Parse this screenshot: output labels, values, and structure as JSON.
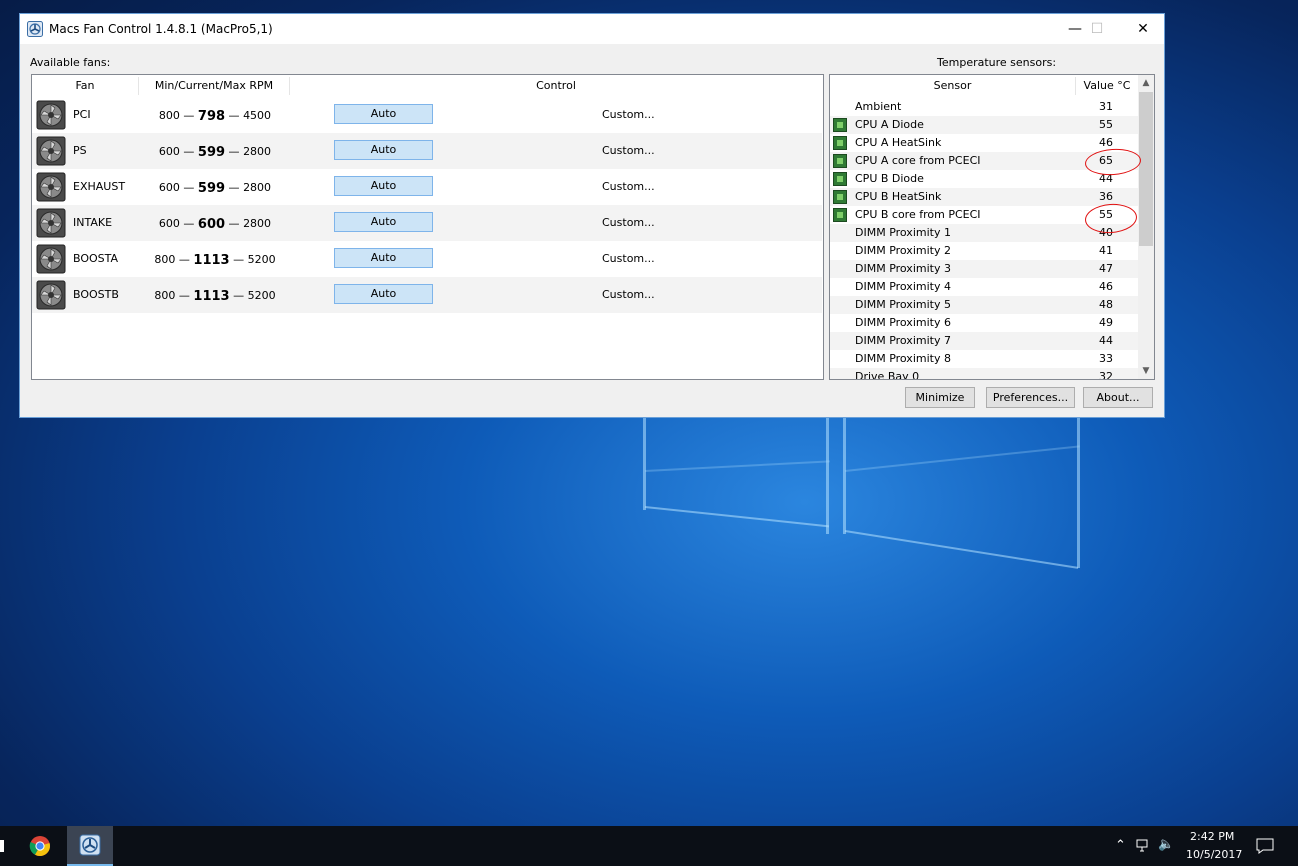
{
  "window": {
    "title": "Macs Fan Control 1.4.8.1 (MacPro5,1)",
    "minimize_glyph": "—",
    "maximize_glyph": "☐",
    "close_glyph": "✕"
  },
  "fans_panel": {
    "label": "Available fans:",
    "headers": {
      "fan": "Fan",
      "rpm": "Min/Current/Max RPM",
      "control": "Control"
    },
    "fans": [
      {
        "name": "PCI",
        "min": "800",
        "current": "798",
        "max": "4500",
        "control": "Auto",
        "custom": "Custom..."
      },
      {
        "name": "PS",
        "min": "600",
        "current": "599",
        "max": "2800",
        "control": "Auto",
        "custom": "Custom..."
      },
      {
        "name": "EXHAUST",
        "min": "600",
        "current": "599",
        "max": "2800",
        "control": "Auto",
        "custom": "Custom..."
      },
      {
        "name": "INTAKE",
        "min": "600",
        "current": "600",
        "max": "2800",
        "control": "Auto",
        "custom": "Custom..."
      },
      {
        "name": "BOOSTA",
        "min": "800",
        "current": "1113",
        "max": "5200",
        "control": "Auto",
        "custom": "Custom..."
      },
      {
        "name": "BOOSTB",
        "min": "800",
        "current": "1113",
        "max": "5200",
        "control": "Auto",
        "custom": "Custom..."
      }
    ]
  },
  "sensors_panel": {
    "label": "Temperature sensors:",
    "headers": {
      "sensor": "Sensor",
      "value": "Value °C"
    },
    "sensors": [
      {
        "name": "Ambient",
        "value": "31",
        "chip": false
      },
      {
        "name": "CPU A Diode",
        "value": "55",
        "chip": true
      },
      {
        "name": "CPU A HeatSink",
        "value": "46",
        "chip": true
      },
      {
        "name": "CPU A core from PCECI",
        "value": "65",
        "chip": true
      },
      {
        "name": "CPU B Diode",
        "value": "44",
        "chip": true
      },
      {
        "name": "CPU B HeatSink",
        "value": "36",
        "chip": true
      },
      {
        "name": "CPU B core from PCECI",
        "value": "55",
        "chip": true
      },
      {
        "name": "DIMM Proximity 1",
        "value": "40",
        "chip": false
      },
      {
        "name": "DIMM Proximity 2",
        "value": "41",
        "chip": false
      },
      {
        "name": "DIMM Proximity 3",
        "value": "47",
        "chip": false
      },
      {
        "name": "DIMM Proximity 4",
        "value": "46",
        "chip": false
      },
      {
        "name": "DIMM Proximity 5",
        "value": "48",
        "chip": false
      },
      {
        "name": "DIMM Proximity 6",
        "value": "49",
        "chip": false
      },
      {
        "name": "DIMM Proximity 7",
        "value": "44",
        "chip": false
      },
      {
        "name": "DIMM Proximity 8",
        "value": "33",
        "chip": false
      },
      {
        "name": "Drive Bay 0",
        "value": "32",
        "chip": false
      }
    ]
  },
  "buttons": {
    "minimize": "Minimize",
    "preferences": "Preferences...",
    "about": "About..."
  },
  "taskbar": {
    "time": "2:42 PM",
    "date": "10/5/2017"
  },
  "colors": {
    "accent": "#cce4f7",
    "annotation": "#e01010",
    "chip": "#2f7a34"
  }
}
